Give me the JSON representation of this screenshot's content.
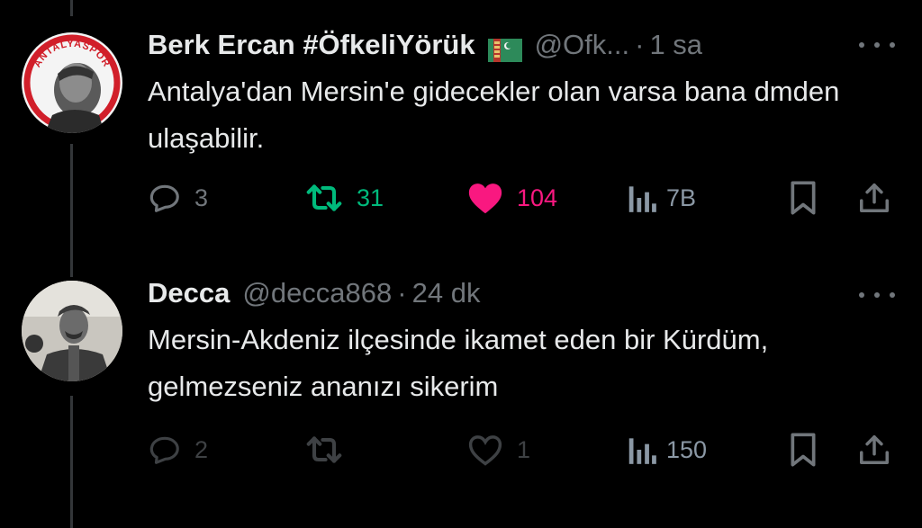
{
  "tweets": [
    {
      "name": "Berk Ercan #ÖfkeliYörük",
      "handle": "@Ofk...",
      "separator": "·",
      "time": "1 sa",
      "avatar_text": "ANTALYASPOR",
      "flag_icon": "turkmenistan-flag-icon",
      "text": "Antalya'dan Mersin'e gidecekler olan varsa bana dmden ulaşabilir.",
      "replies": "3",
      "retweets": "31",
      "likes": "104",
      "views": "7B",
      "colors": {
        "retweet": "#00ba7c",
        "like": "#f91880"
      }
    },
    {
      "name": "Decca",
      "handle": "@decca868",
      "separator": "·",
      "time": "24 dk",
      "text": "Mersin-Akdeniz ilçesinde ikamet eden bir Kürdüm, gelmezseniz ananızı sikerim",
      "replies": "2",
      "retweets": "",
      "likes": "1",
      "views": "150"
    }
  ],
  "theme": {
    "background": "#000000",
    "text": "#e7e9ea",
    "muted": "#71767b"
  }
}
